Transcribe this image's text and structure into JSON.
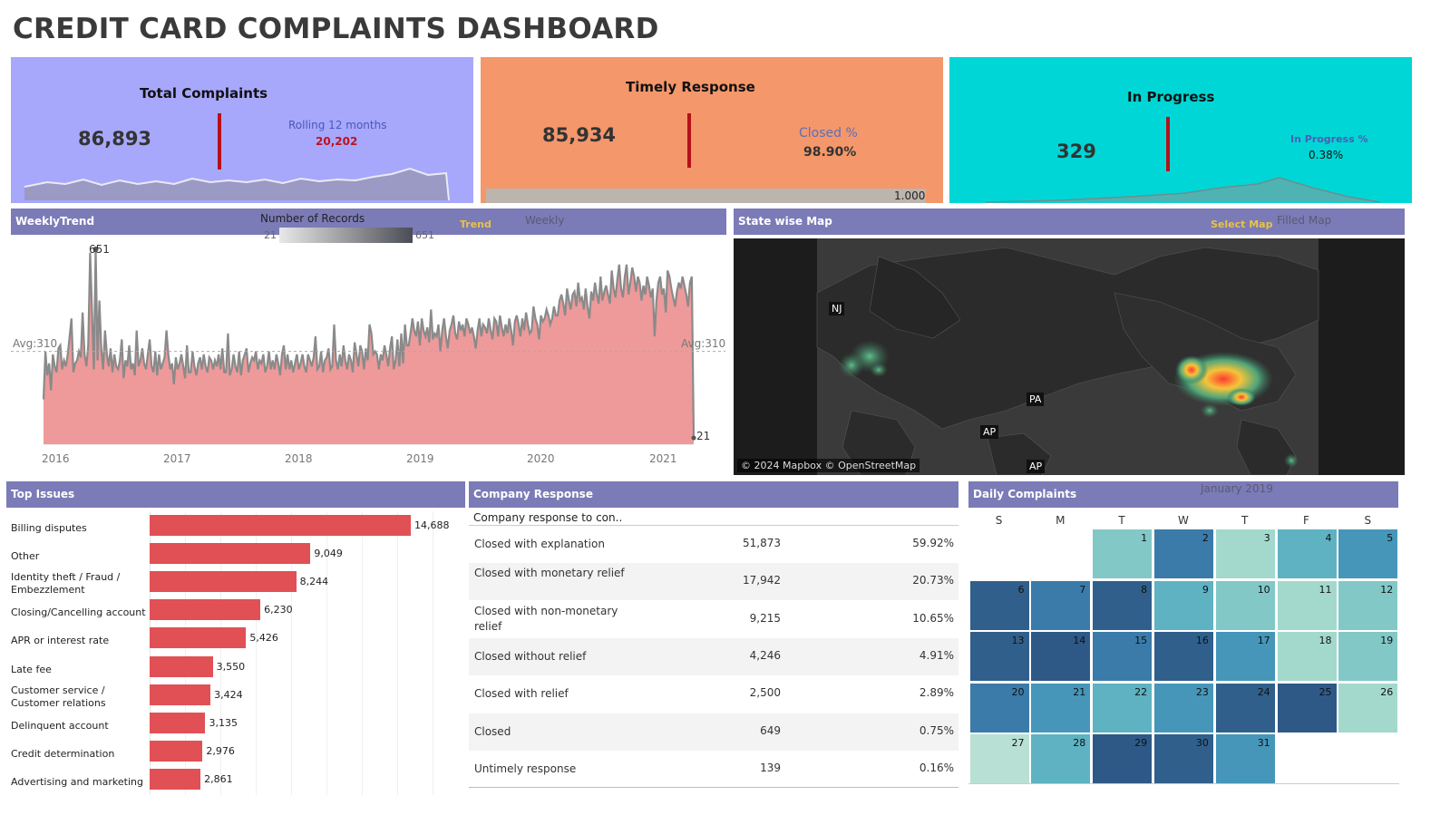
{
  "title": "CREDIT CARD COMPLAINTS DASHBOARD",
  "kpis": {
    "total": {
      "title": "Total Complaints",
      "value": "86,893",
      "sub_label": "Rolling 12 months",
      "sub_value": "20,202"
    },
    "timely": {
      "title": "Timely Response",
      "value": "85,934",
      "sub_label": "Closed %",
      "sub_value": "98.90%",
      "bar_label": "1.000"
    },
    "progress": {
      "title": "In  Progress",
      "value": "329",
      "sub_label": "In Progress %",
      "sub_value": "0.38%"
    }
  },
  "weekly": {
    "header": "WeeklyTrend",
    "legend_title": "Number of Records",
    "legend_min": "21",
    "legend_max": "651",
    "trend_label": "Trend",
    "weekly_label": "Weekly",
    "avg_left": "Avg:310",
    "avg_right": "Avg:310",
    "peak_label": "651",
    "end_label": "21",
    "years": [
      "2016",
      "2017",
      "2018",
      "2019",
      "2020",
      "2021"
    ]
  },
  "map": {
    "header": "State wise Map",
    "select_label": "Select Map",
    "filled_label": "Filled Map",
    "attribution": "© 2024 Mapbox © OpenStreetMap",
    "labels": [
      "NJ",
      "PA",
      "AP",
      "AP"
    ]
  },
  "issues": {
    "header": "Top Issues",
    "items": [
      {
        "label": "Billing disputes",
        "value": "14,688",
        "num": 14688
      },
      {
        "label": "Other",
        "value": "9,049",
        "num": 9049
      },
      {
        "label": "Identity theft / Fraud / Embezzlement",
        "value": "8,244",
        "num": 8244
      },
      {
        "label": "Closing/Cancelling account",
        "value": "6,230",
        "num": 6230
      },
      {
        "label": "APR or interest rate",
        "value": "5,426",
        "num": 5426
      },
      {
        "label": "Late fee",
        "value": "3,550",
        "num": 3550
      },
      {
        "label": "Customer service / Customer relations",
        "value": "3,424",
        "num": 3424
      },
      {
        "label": "Delinquent account",
        "value": "3,135",
        "num": 3135
      },
      {
        "label": "Credit determination",
        "value": "2,976",
        "num": 2976
      },
      {
        "label": "Advertising and marketing",
        "value": "2,861",
        "num": 2861
      }
    ]
  },
  "response": {
    "header": "Company Response",
    "column_header": "Company response to con..",
    "rows": [
      {
        "label": "Closed with explanation",
        "count": "51,873",
        "pct": "59.92%"
      },
      {
        "label": "Closed with monetary relief",
        "count": "17,942",
        "pct": "20.73%"
      },
      {
        "label": "Closed with non-monetary relief",
        "count": "9,215",
        "pct": "10.65%"
      },
      {
        "label": "Closed without relief",
        "count": "4,246",
        "pct": "4.91%"
      },
      {
        "label": "Closed with relief",
        "count": "2,500",
        "pct": "2.89%"
      },
      {
        "label": "Closed",
        "count": "649",
        "pct": "0.75%"
      },
      {
        "label": "Untimely response",
        "count": "139",
        "pct": "0.16%"
      }
    ]
  },
  "calendar": {
    "header": "Daily Complaints",
    "month": "January 2019",
    "dow": [
      "S",
      "M",
      "T",
      "W",
      "T",
      "F",
      "S"
    ],
    "levels": [
      2,
      5,
      1,
      3,
      4,
      6,
      5,
      6,
      3,
      2,
      1,
      2,
      6,
      7,
      5,
      6,
      4,
      1,
      2,
      5,
      4,
      3,
      4,
      6,
      7,
      1,
      0,
      3,
      7,
      6,
      4,
      6,
      7,
      5,
      1
    ],
    "colors": [
      "#b8e0d4",
      "#a3d9cd",
      "#82c8c7",
      "#5eb2c2",
      "#4596b9",
      "#3a7ba9",
      "#305f8c",
      "#2e5987"
    ]
  },
  "chart_data": {
    "type": "area",
    "title": "WeeklyTrend",
    "x_range": [
      "2016",
      "2021"
    ],
    "ylim": [
      21,
      651
    ],
    "avg": 310,
    "peak": 651,
    "last": 21,
    "values": [
      150,
      310,
      230,
      270,
      180,
      300,
      260,
      240,
      320,
      330,
      250,
      280,
      260,
      300,
      360,
      420,
      240,
      270,
      280,
      310,
      290,
      440,
      300,
      260,
      330,
      640,
      450,
      250,
      651,
      280,
      480,
      320,
      250,
      380,
      300,
      260,
      320,
      240,
      300,
      260,
      250,
      280,
      350,
      220,
      280,
      260,
      330,
      250,
      270,
      230,
      380,
      260,
      280,
      320,
      270,
      250,
      300,
      350,
      260,
      240,
      310,
      230,
      300,
      250,
      270,
      290,
      380,
      300,
      250,
      270,
      200,
      290,
      250,
      270,
      300,
      260,
      220,
      330,
      240,
      240,
      310,
      260,
      230,
      270,
      290,
      250,
      300,
      260,
      240,
      290,
      280,
      250,
      280,
      260,
      300,
      250,
      320,
      240,
      240,
      370,
      230,
      250,
      300,
      260,
      240,
      310,
      230,
      280,
      300,
      320,
      240,
      270,
      290,
      280,
      310,
      250,
      280,
      270,
      300,
      240,
      260,
      310,
      250,
      280,
      250,
      300,
      270,
      230,
      300,
      330,
      250,
      300,
      250,
      280,
      240,
      270,
      300,
      250,
      270,
      300,
      260,
      240,
      300,
      280,
      260,
      290,
      360,
      250,
      260,
      310,
      240,
      280,
      290,
      320,
      250,
      260,
      400,
      280,
      250,
      300,
      260,
      330,
      280,
      250,
      300,
      280,
      240,
      340,
      300,
      260,
      330,
      310,
      250,
      320,
      280,
      400,
      370,
      300,
      310,
      300,
      250,
      300,
      280,
      330,
      300,
      260,
      320,
      360,
      250,
      280,
      350,
      260,
      370,
      270,
      400,
      330,
      330,
      370,
      420,
      380,
      360,
      410,
      330,
      420,
      380,
      360,
      390,
      340,
      450,
      350,
      370,
      360,
      400,
      310,
      380,
      420,
      360,
      320,
      380,
      400,
      430,
      370,
      350,
      410,
      380,
      400,
      360,
      420,
      400,
      370,
      390,
      360,
      320,
      380,
      420,
      360,
      400,
      390,
      370,
      420,
      380,
      350,
      420,
      410,
      360,
      430,
      390,
      360,
      400,
      370,
      420,
      380,
      330,
      410,
      430,
      400,
      360,
      420,
      380,
      440,
      400,
      370,
      380,
      460,
      420,
      400,
      350,
      430,
      410,
      420,
      450,
      430,
      400,
      420,
      460,
      430,
      430,
      480,
      500,
      470,
      430,
      520,
      480,
      450,
      500,
      510,
      460,
      540,
      480,
      490,
      450,
      520,
      460,
      420,
      510,
      480,
      540,
      500,
      470,
      560,
      480,
      510,
      530,
      500,
      470,
      580,
      520,
      490,
      550,
      600,
      520,
      490,
      560,
      600,
      500,
      540,
      590,
      560,
      510,
      560,
      540,
      480,
      530,
      500,
      560,
      530,
      490,
      520,
      360,
      480,
      540,
      560,
      500,
      520,
      440,
      580,
      560,
      520,
      490,
      460,
      510,
      540,
      520,
      560,
      530,
      500,
      460,
      540,
      560,
      21
    ]
  }
}
